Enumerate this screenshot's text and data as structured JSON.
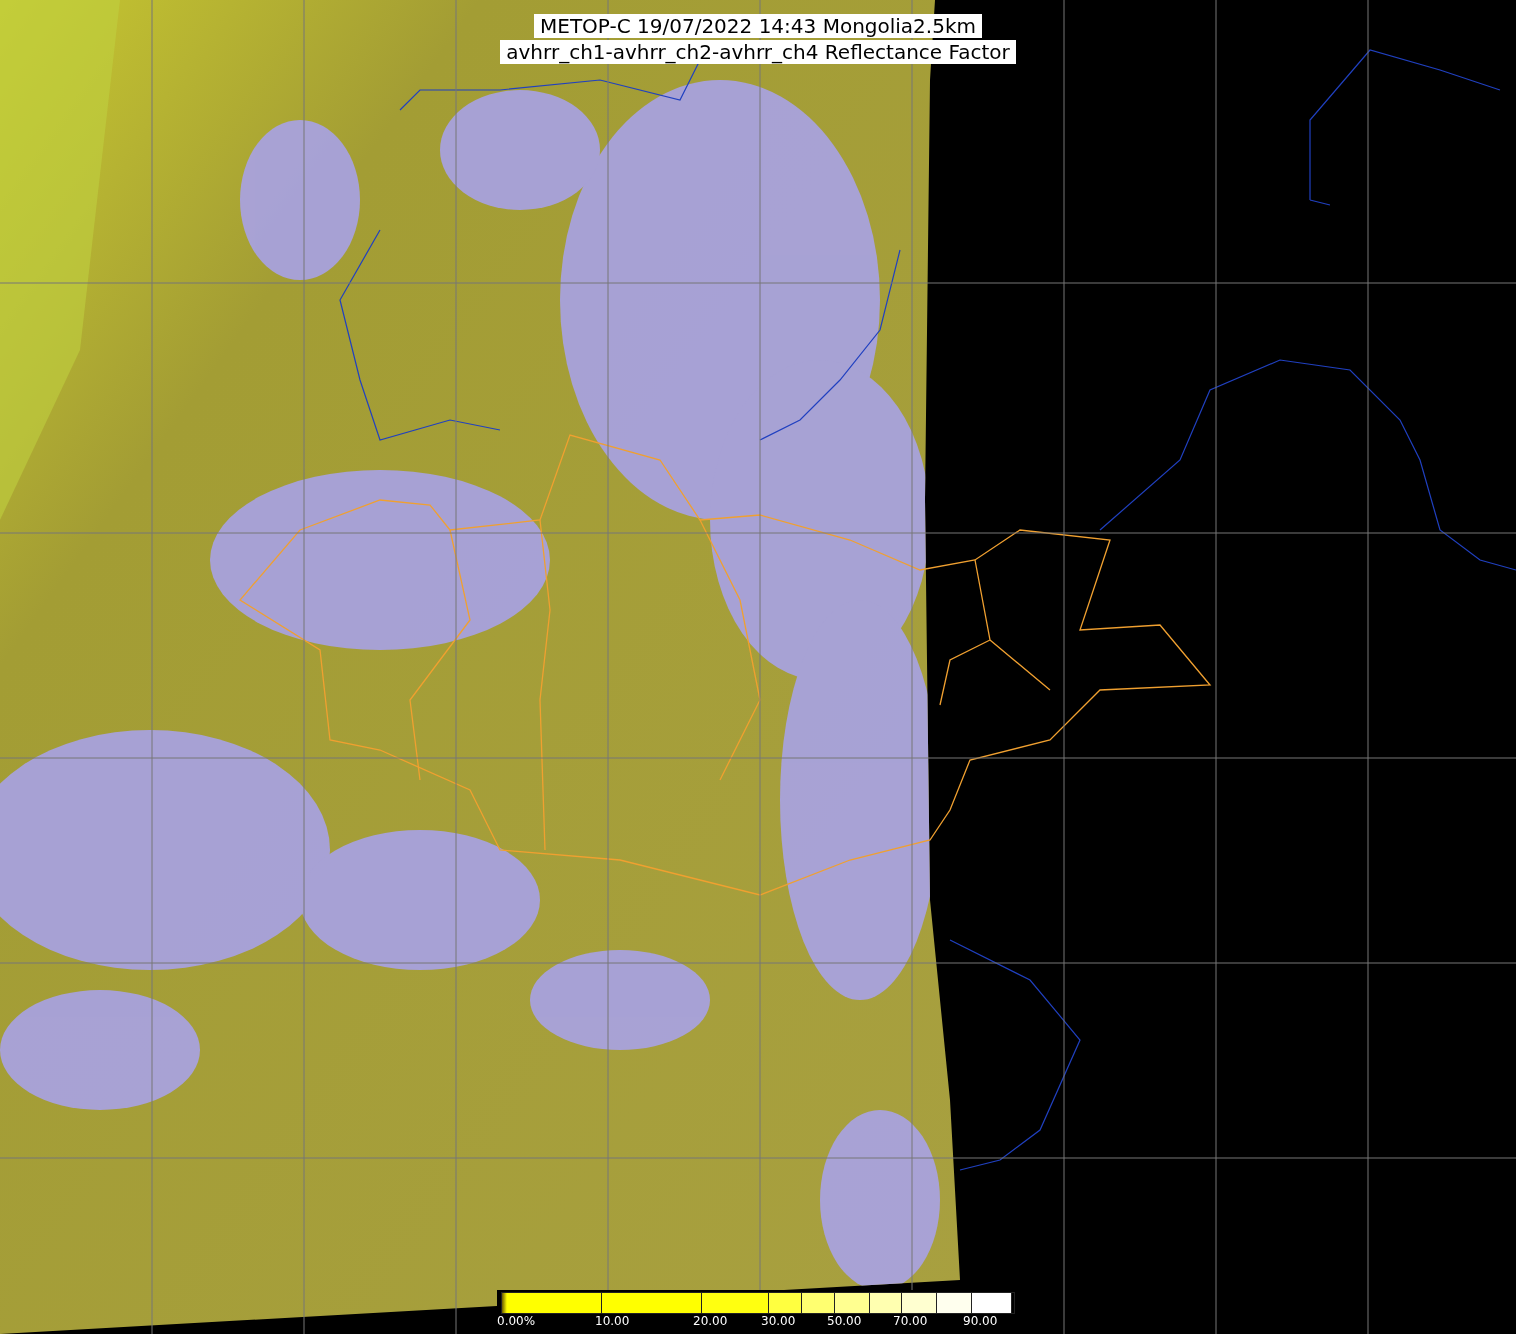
{
  "title": {
    "lines": [
      "METOP-C 19/07/2022 14:43 Mongolia2.5km",
      "avhrr_ch1-avhrr_ch2-avhrr_ch4 Reflectance Factor"
    ]
  },
  "colorbar": {
    "labels": [
      "0.00%",
      "10.00",
      "20.00",
      "30.00",
      "50.00",
      "70.00",
      "90.00"
    ]
  }
}
